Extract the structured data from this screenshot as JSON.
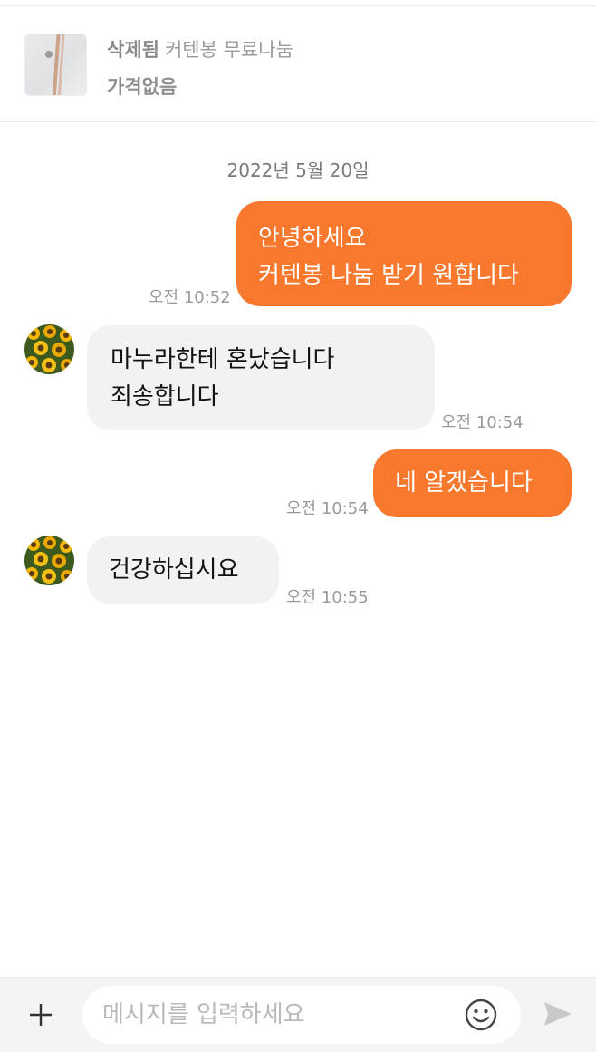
{
  "product": {
    "status": "삭제됨",
    "title": "커텐봉 무료나눔",
    "price": "가격없음"
  },
  "chat": {
    "date": "2022년 5월 20일",
    "messages": [
      {
        "sender": "me",
        "lines": [
          "안녕하세요",
          "커텐봉 나눔 받기 원합니다"
        ],
        "time": "오전 10:52"
      },
      {
        "sender": "other",
        "lines": [
          "마누라한테 혼났습니다",
          "죄송합니다"
        ],
        "time": "오전 10:54"
      },
      {
        "sender": "me",
        "lines": [
          "네 알겠습니다"
        ],
        "time": "오전 10:54"
      },
      {
        "sender": "other",
        "lines": [
          "건강하십시요"
        ],
        "time": "오전 10:55"
      }
    ]
  },
  "composer": {
    "placeholder": "메시지를 입력하세요",
    "value": ""
  },
  "colors": {
    "accent": "#f8782e",
    "their_bubble": "#f2f2f4",
    "timestamp": "#9a9a9a",
    "input_bar": "#f4f4f6"
  },
  "icons": {
    "add": "plus-icon",
    "emoji": "smiley-icon",
    "send": "send-icon"
  }
}
